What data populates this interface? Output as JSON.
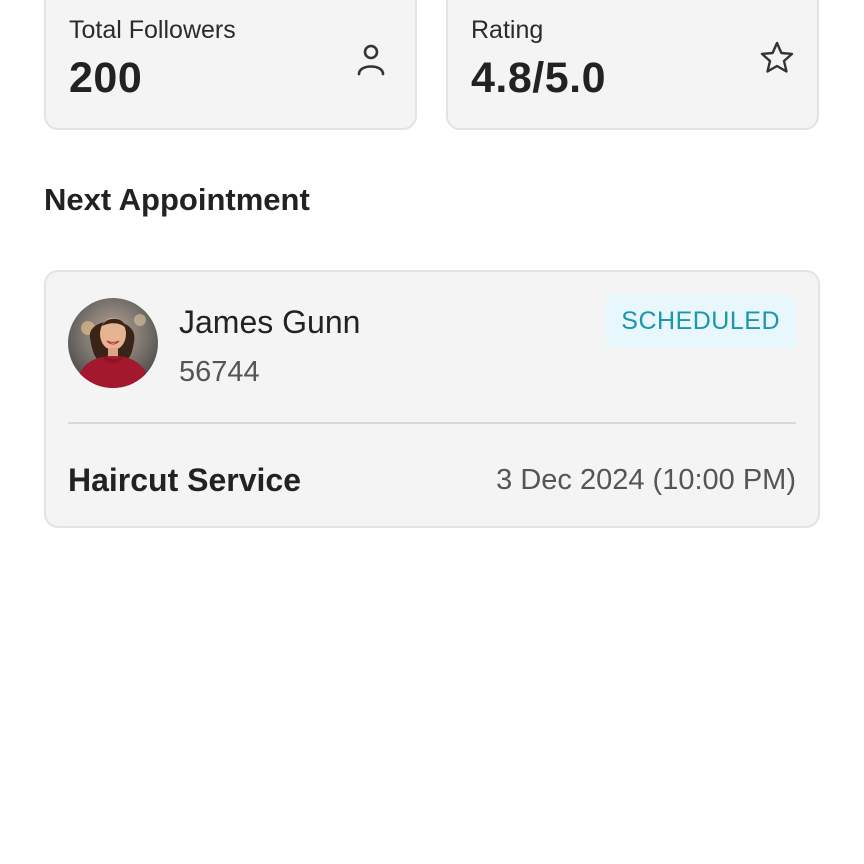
{
  "stats": {
    "followers": {
      "label": "Total Followers",
      "value": "200",
      "icon": "person-icon"
    },
    "rating": {
      "label": "Rating",
      "value": "4.8/5.0",
      "icon": "star-icon"
    }
  },
  "next_appointment": {
    "section_title": "Next Appointment",
    "client_name": "James Gunn",
    "client_id": "56744",
    "status": "SCHEDULED",
    "service": "Haircut Service",
    "datetime": "3 Dec 2024 (10:00 PM)"
  },
  "colors": {
    "card_background": "#f4f4f4",
    "status_text": "#1b95b0",
    "status_background": "#e8f7fb"
  }
}
